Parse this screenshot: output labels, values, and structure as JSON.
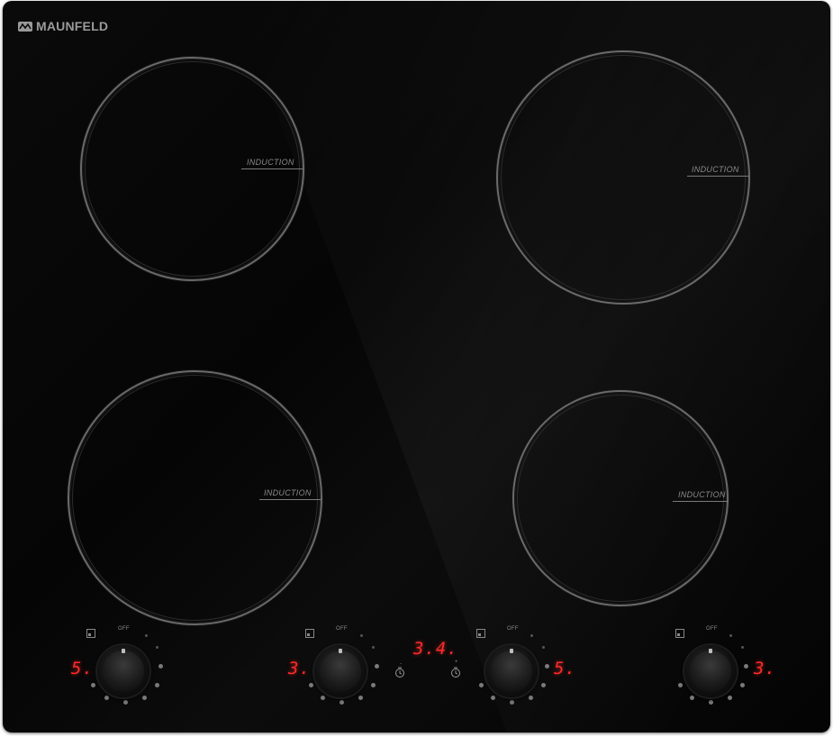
{
  "brand": {
    "name": "MAUNFELD",
    "logo_icon": "maunfeld-logo-icon"
  },
  "zones": [
    {
      "id": "rear-left",
      "label": "INDUCTION"
    },
    {
      "id": "rear-right",
      "label": "INDUCTION"
    },
    {
      "id": "front-left",
      "label": "INDUCTION"
    },
    {
      "id": "front-right",
      "label": "INDUCTION"
    }
  ],
  "controls": [
    {
      "id": "knob-1",
      "off_label": "OFF",
      "display": "5."
    },
    {
      "id": "knob-2",
      "off_label": "OFF",
      "display": "3."
    },
    {
      "id": "knob-3",
      "off_label": "OFF",
      "display": "5."
    },
    {
      "id": "knob-4",
      "off_label": "OFF",
      "display": "3."
    }
  ],
  "timer": {
    "display": "3.4.",
    "minus_label": "-",
    "plus_label": "+",
    "icon": "timer-icon"
  },
  "colors": {
    "glass": "#050505",
    "ring": "#6a6a6a",
    "led": "#ff2a2a"
  }
}
